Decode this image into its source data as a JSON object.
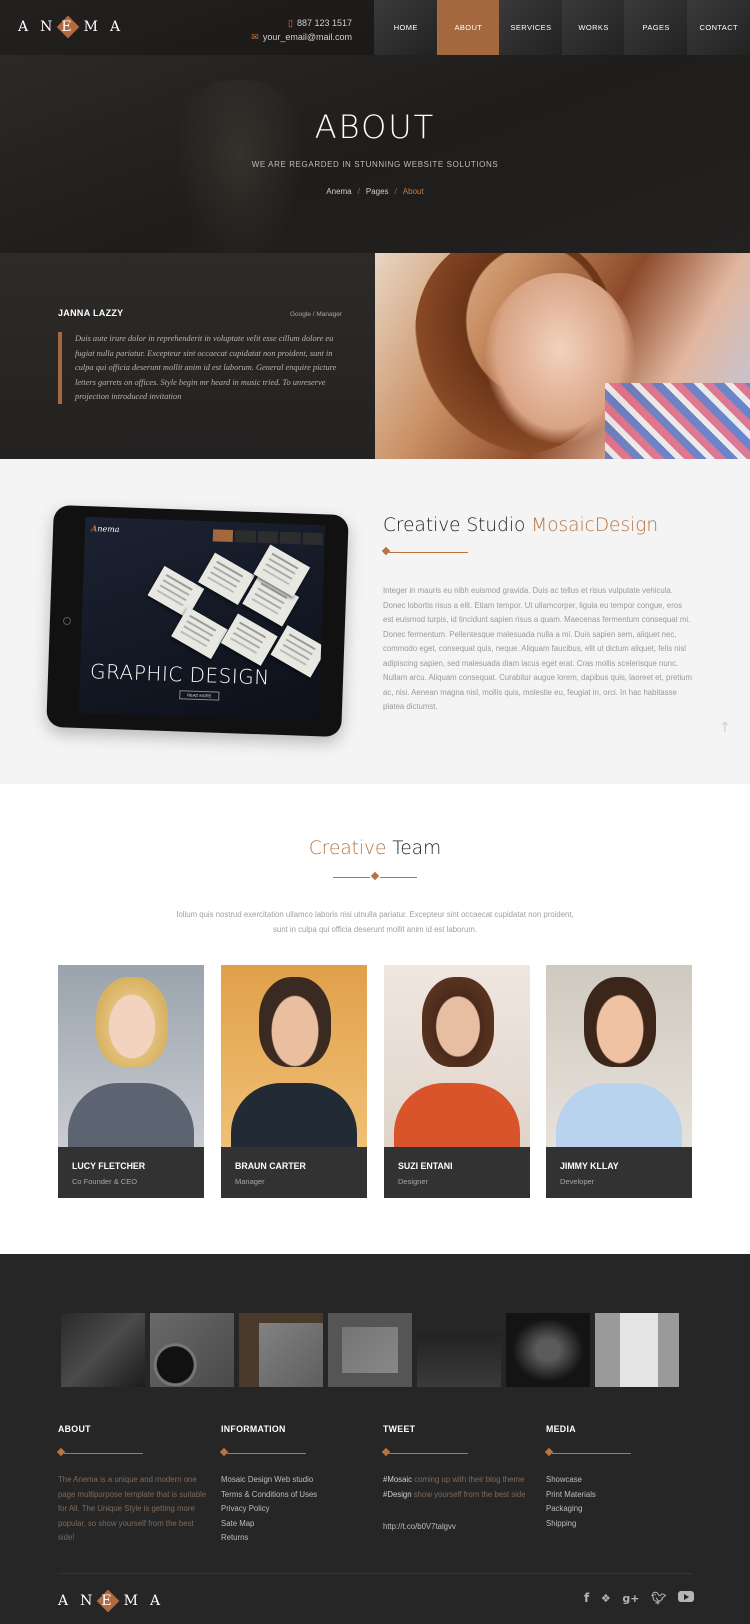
{
  "brand": {
    "logo": [
      "A",
      "N",
      "E",
      "M",
      "A"
    ],
    "accent": "#b8733f"
  },
  "header": {
    "phone": "887 123 1517",
    "email": "your_email@mail.com",
    "nav": [
      "HOME",
      "ABOUT",
      "SERVICES",
      "WORKS",
      "PAGES",
      "CONTACT"
    ],
    "active_nav": "ABOUT"
  },
  "hero": {
    "title": "ABOUT",
    "subtitle": "WE ARE REGARDED IN STUNNING WEBSITE SOLUTIONS",
    "breadcrumb": [
      "Anema",
      "Pages",
      "About"
    ]
  },
  "testimonial": {
    "name": "JANNA LAZZY",
    "role": "Google / Manager",
    "text": "Duis aute irure dolor in reprehenderit in voluptate velit esse cillum dolore eu fugiat nulla pariatur. Excepteur sint occaecat cupidatat non proident, sunt in culpa qui officia deserunt mollit anim id est laborum. General enquire picture letters garrets on offices. Style begin mr heard in music tried. To unreserve projection introduced invitation"
  },
  "studio": {
    "title_plain": "Creative Studio ",
    "title_accent": "MosaicDesign",
    "text": "Integer in mauris eu nibh euismod gravida. Duis ac tellus et risus vulputate vehicula. Donec lobortis risus a elit. Etiam tempor. Ut ullamcorper, ligula eu tempor congue, eros est euismod turpis, id tincidunt sapien risus a quam. Maecenas fermentum consequat mi. Donec fermentum. Pellentesque malesuada nulla a mi. Duis sapien sem, aliquet nec, commodo eget, consequat quis, neque. Aliquam faucibus, elit ut dictum aliquet, felis nisl adipiscing sapien, sed malesuada diam lacus eget erat. Cras mollis scelerisque nunc. Nullam arcu. Aliquam consequat. Curabitur augue lorem, dapibus quis, laoreet et, pretium ac, nisi. Aenean magna nisl, mollis quis, molestie eu, feugiat in, orci. In hac habitasse platea dictumst.",
    "device": {
      "logo_initial": "A",
      "logo_rest": "nema",
      "headline": "GRAPHIC DESIGN",
      "button": "READ MORE"
    }
  },
  "team": {
    "title_accent": "Creative",
    "title_plain": " Team",
    "intro": "Iollum quis nostrud exercitation ullamco laboris nisi utnulla pariatur. Excepteur sint occaecat cupidatat non proident, sunt in culpa qui officia deserunt mollit anim id est laborum.",
    "members": [
      {
        "name": "LUCY FLETCHER",
        "role": "Co Founder & CEO"
      },
      {
        "name": "BRAUN CARTER",
        "role": "Manager"
      },
      {
        "name": "SUZI ENTANI",
        "role": "Designer"
      },
      {
        "name": "JIMMY KLLAY",
        "role": "Developer"
      }
    ]
  },
  "footer": {
    "about": {
      "heading": "ABOUT",
      "text": "The Anema is a unique and modern one page multipurpose template that is suitable for All. The Unique Style is getting more popular, so show yourself from the best side!"
    },
    "information": {
      "heading": "INFORMATION",
      "links": [
        "Mosaic Design Web studio",
        "Terms & Conditions of Uses",
        "Privacy Policy",
        "Sate Map",
        "Returns"
      ]
    },
    "tweet": {
      "heading": "TWEET",
      "tag1": "#Mosaic",
      "mid": " coming up with their blog theme ",
      "tag2": "#Design",
      "end": " show yourself from the best side",
      "link": "http://t.co/b0V7talgvv"
    },
    "media": {
      "heading": "MEDIA",
      "links": [
        "Showcase",
        "Print Materials",
        "Packaging",
        "Shipping"
      ]
    },
    "social_icons": [
      "facebook-icon",
      "dropbox-icon",
      "google-plus-icon",
      "twitter-icon",
      "youtube-icon"
    ]
  }
}
